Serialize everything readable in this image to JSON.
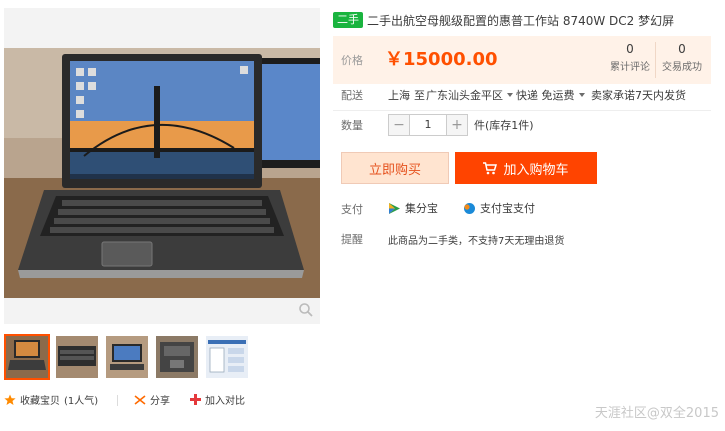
{
  "title": {
    "tag": "二手",
    "text": "二手出航空母舰级配置的惠普工作站 8740W DC2 梦幻屏"
  },
  "price": {
    "label": "价格",
    "value": "￥15000.00",
    "stats": [
      {
        "num": "0",
        "label": "累计评论"
      },
      {
        "num": "0",
        "label": "交易成功"
      }
    ]
  },
  "delivery": {
    "label": "配送",
    "from": "上海",
    "to_word": "至",
    "to": "广东汕头金平区",
    "shipping": "快递 免运费",
    "promise": "卖家承诺7天内发货"
  },
  "quantity": {
    "label": "数量",
    "minus": "−",
    "value": "1",
    "plus": "+",
    "stock": "件(库存1件)"
  },
  "buttons": {
    "buy_now": "立即购买",
    "add_cart": "加入购物车"
  },
  "payment": {
    "label": "支付",
    "options": [
      "集分宝",
      "支付宝支付"
    ]
  },
  "notice": {
    "label": "提醒",
    "text": "此商品为二手类，不支持7天无理由退货"
  },
  "actions": {
    "favorite": "收藏宝贝",
    "popularity": "(1人气)",
    "share": "分享",
    "compare": "加入对比"
  },
  "watermark": "天涯社区@双全2015",
  "colors": {
    "accent": "#ff5000",
    "cart_button": "#ff4400",
    "price_bg": "#fff2e8",
    "tag_green": "#1ab43f"
  }
}
